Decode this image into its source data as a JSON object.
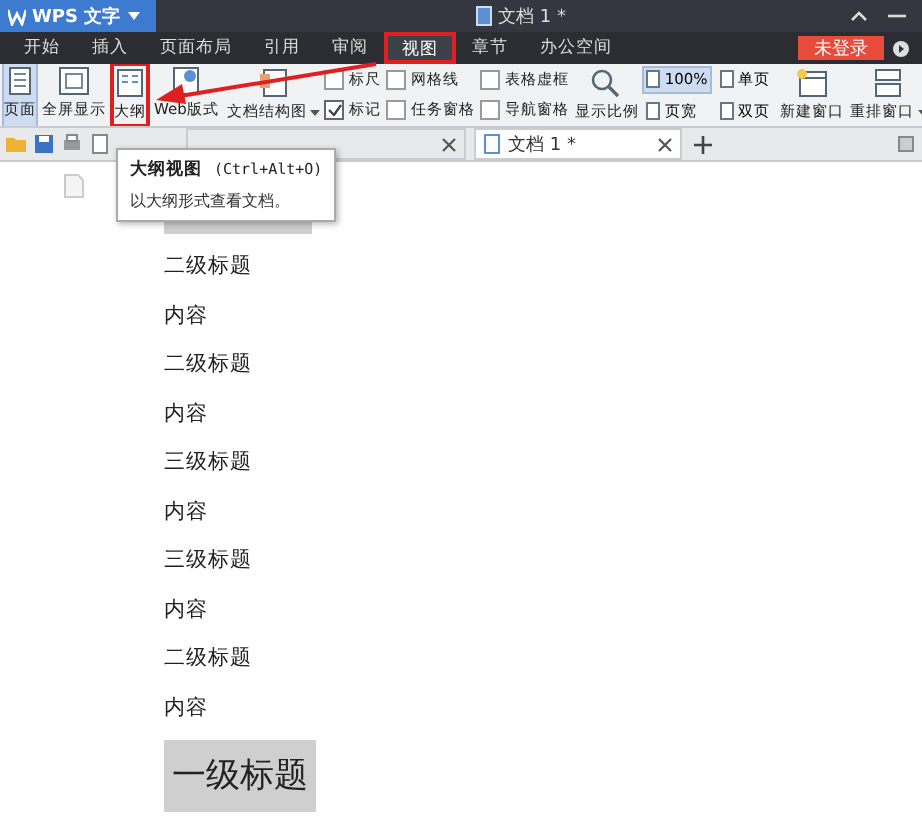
{
  "app_button": {
    "label": "WPS 文字"
  },
  "window": {
    "title": "文档 1 *"
  },
  "menu": [
    {
      "label": "开始",
      "selected": false,
      "highlighted": false
    },
    {
      "label": "插入",
      "selected": false,
      "highlighted": false
    },
    {
      "label": "页面布局",
      "selected": false,
      "highlighted": false
    },
    {
      "label": "引用",
      "selected": false,
      "highlighted": false
    },
    {
      "label": "审阅",
      "selected": false,
      "highlighted": false
    },
    {
      "label": "视图",
      "selected": true,
      "highlighted": true
    },
    {
      "label": "章节",
      "selected": false,
      "highlighted": false
    },
    {
      "label": "办公空间",
      "selected": false,
      "highlighted": false
    }
  ],
  "login_button": {
    "label": "未登录"
  },
  "ribbon": {
    "views": [
      {
        "label": "页面",
        "selected": true,
        "highlighted": false
      },
      {
        "label": "全屏显示",
        "selected": false,
        "highlighted": false
      },
      {
        "label": "大纲",
        "selected": false,
        "highlighted": true
      },
      {
        "label": "Web版式",
        "selected": false,
        "highlighted": false
      }
    ],
    "structure_button": {
      "label": "文档结构图"
    },
    "checkboxes": [
      {
        "label": "标尺",
        "checked": false
      },
      {
        "label": "标记",
        "checked": true
      },
      {
        "label": "网格线",
        "checked": false
      },
      {
        "label": "任务窗格",
        "checked": false
      },
      {
        "label": "表格虚框",
        "checked": false
      },
      {
        "label": "导航窗格",
        "checked": false
      }
    ],
    "zoom_button": {
      "label": "显示比例"
    },
    "zoom_options": [
      {
        "label": "100%",
        "selected": true
      },
      {
        "label": "单页",
        "selected": false
      },
      {
        "label": "页宽",
        "selected": false
      },
      {
        "label": "双页",
        "selected": false
      }
    ],
    "window_buttons": [
      {
        "label": "新建窗口",
        "dropdown": false
      },
      {
        "label": "重排窗口",
        "dropdown": true
      }
    ]
  },
  "doc_tabs": [
    {
      "selected": false
    },
    {
      "label": "文档 1 *",
      "selected": true
    }
  ],
  "tooltip": {
    "title": "大纲视图",
    "shortcut": "(Ctrl+Alt+O)",
    "text": "以大纲形式查看文档。"
  },
  "document": [
    {
      "kind": "heading1"
    },
    {
      "kind": "heading2",
      "text": "二级标题"
    },
    {
      "kind": "body",
      "text": "内容"
    },
    {
      "kind": "heading2",
      "text": "二级标题"
    },
    {
      "kind": "body",
      "text": "内容"
    },
    {
      "kind": "heading3",
      "text": "三级标题"
    },
    {
      "kind": "body",
      "text": "内容"
    },
    {
      "kind": "heading3",
      "text": "三级标题"
    },
    {
      "kind": "body",
      "text": "内容"
    },
    {
      "kind": "heading2",
      "text": "二级标题"
    },
    {
      "kind": "body",
      "text": "内容"
    },
    {
      "kind": "heading1",
      "text": "一级标题"
    }
  ]
}
